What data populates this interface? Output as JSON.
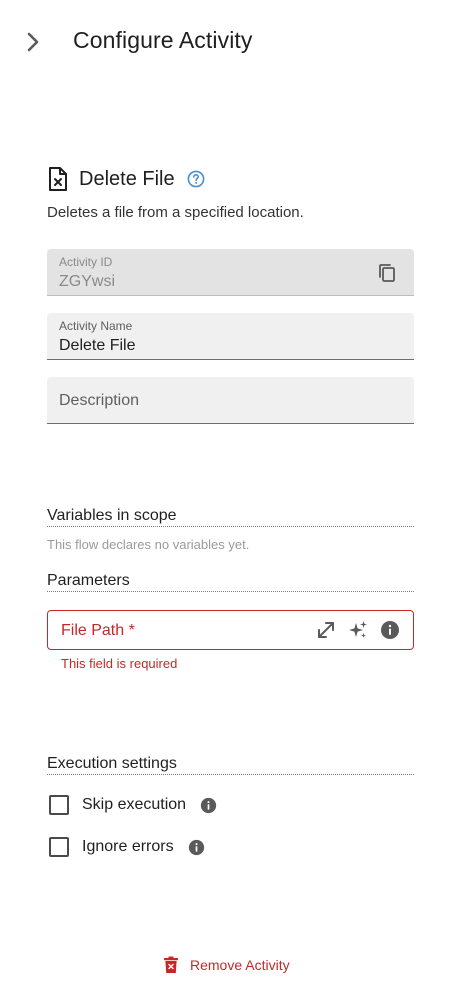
{
  "header": {
    "title": "Configure Activity",
    "collapse_icon": "chevron-right-icon"
  },
  "activity": {
    "title": "Delete File",
    "description": "Deletes a file from a specified location.",
    "icon": "file-delete-icon",
    "help_icon": "help-circle-icon"
  },
  "fields": {
    "activity_id": {
      "label": "Activity ID",
      "value": "ZGYwsi",
      "disabled": true
    },
    "activity_name": {
      "label": "Activity Name",
      "value": "Delete File"
    },
    "description": {
      "placeholder": "Description",
      "value": ""
    }
  },
  "variables": {
    "title": "Variables in scope",
    "empty_text": "This flow declares no variables yet."
  },
  "parameters": {
    "title": "Parameters",
    "file_path": {
      "label": "File Path *",
      "error": "This field is required",
      "icons": [
        "expand-icon",
        "sparkle-icon",
        "info-icon"
      ]
    }
  },
  "execution": {
    "title": "Execution settings",
    "skip": {
      "label": "Skip execution",
      "checked": false
    },
    "ignore": {
      "label": "Ignore errors",
      "checked": false
    }
  },
  "remove": {
    "label": "Remove Activity"
  },
  "colors": {
    "error": "#c62828",
    "help": "#4a8fd4",
    "field_bg": "#f0f0f0",
    "disabled_bg": "#e3e3e3"
  }
}
